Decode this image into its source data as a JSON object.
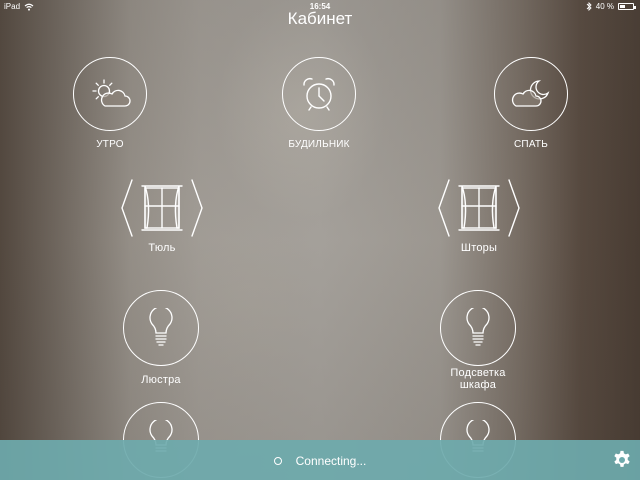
{
  "status_bar": {
    "device": "iPad",
    "time": "16:54",
    "battery": "40 %",
    "battery_level": 0.4
  },
  "header": {
    "title": "Кабинет"
  },
  "scenes": [
    {
      "label": "УТРО",
      "icon": "sun-cloud-icon"
    },
    {
      "label": "БУДИЛЬНИК",
      "icon": "alarm-clock-icon"
    },
    {
      "label": "СПАТЬ",
      "icon": "moon-cloud-icon"
    }
  ],
  "blinds": [
    {
      "label": "Тюль",
      "icon": "curtain-window-icon"
    },
    {
      "label": "Шторы",
      "icon": "curtain-window-icon"
    }
  ],
  "lights": [
    {
      "label": "Люстра",
      "icon": "light-bulb-icon"
    },
    {
      "label_line1": "Подсветка",
      "label_line2": "шкафа",
      "icon": "light-bulb-icon"
    }
  ],
  "bottom_bar": {
    "status_text": "Connecting...",
    "settings_icon": "gear-icon",
    "color": "#6eaaac"
  }
}
